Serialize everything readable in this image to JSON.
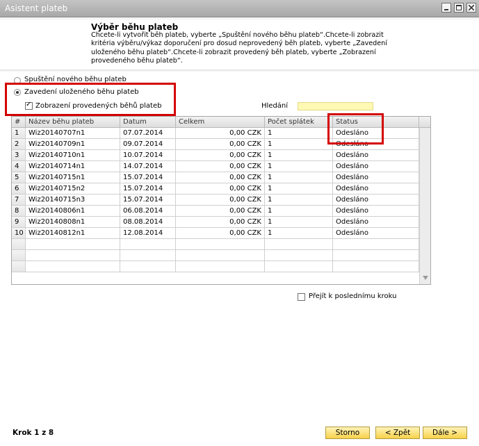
{
  "window": {
    "title": "Asistent plateb"
  },
  "header": {
    "title": "Výběr běhu plateb",
    "description": "Chcete-li vytvořit běh plateb, vyberte „Spuštění nového běhu plateb“.Chcete-li zobrazit kritéria výběru/výkaz doporučení pro dosud neprovedený běh plateb, vyberte „Zavedení uloženého běhu plateb“.Chcete-li zobrazit provedený běh plateb, vyberte „Zobrazení provedeného běhu plateb“."
  },
  "options": {
    "radio_new": "Spuštění nového běhu plateb",
    "radio_saved": "Zavedení uloženého běhu plateb",
    "check_executed": "Zobrazení provedených běhů plateb",
    "search_label": "Hledání",
    "search_value": ""
  },
  "table": {
    "columns": [
      "#",
      "Název běhu plateb",
      "Datum",
      "Celkem",
      "Počet splátek",
      "Status"
    ],
    "rows": [
      [
        "1",
        "Wiz20140707n1",
        "07.07.2014",
        "0,00 CZK",
        "1",
        "Odesláno"
      ],
      [
        "2",
        "Wiz20140709n1",
        "09.07.2014",
        "0,00 CZK",
        "1",
        "Odesláno"
      ],
      [
        "3",
        "Wiz20140710n1",
        "10.07.2014",
        "0,00 CZK",
        "1",
        "Odesláno"
      ],
      [
        "4",
        "Wiz20140714n1",
        "14.07.2014",
        "0,00 CZK",
        "1",
        "Odesláno"
      ],
      [
        "5",
        "Wiz20140715n1",
        "15.07.2014",
        "0,00 CZK",
        "1",
        "Odesláno"
      ],
      [
        "6",
        "Wiz20140715n2",
        "15.07.2014",
        "0,00 CZK",
        "1",
        "Odesláno"
      ],
      [
        "7",
        "Wiz20140715n3",
        "15.07.2014",
        "0,00 CZK",
        "1",
        "Odesláno"
      ],
      [
        "8",
        "Wiz20140806n1",
        "06.08.2014",
        "0,00 CZK",
        "1",
        "Odesláno"
      ],
      [
        "9",
        "Wiz20140808n1",
        "08.08.2014",
        "0,00 CZK",
        "1",
        "Odesláno"
      ],
      [
        "10",
        "Wiz20140812n1",
        "12.08.2014",
        "0,00 CZK",
        "1",
        "Odesláno"
      ]
    ]
  },
  "goto_last_step": "Přejít k poslednímu kroku",
  "footer": {
    "step": "Krok 1 z 8",
    "cancel": "Storno",
    "back": "< Zpět",
    "next": "Dále >"
  },
  "colors": {
    "highlight": "#d40000",
    "button": "#f7d24a",
    "search_bg": "#fff9b3"
  }
}
